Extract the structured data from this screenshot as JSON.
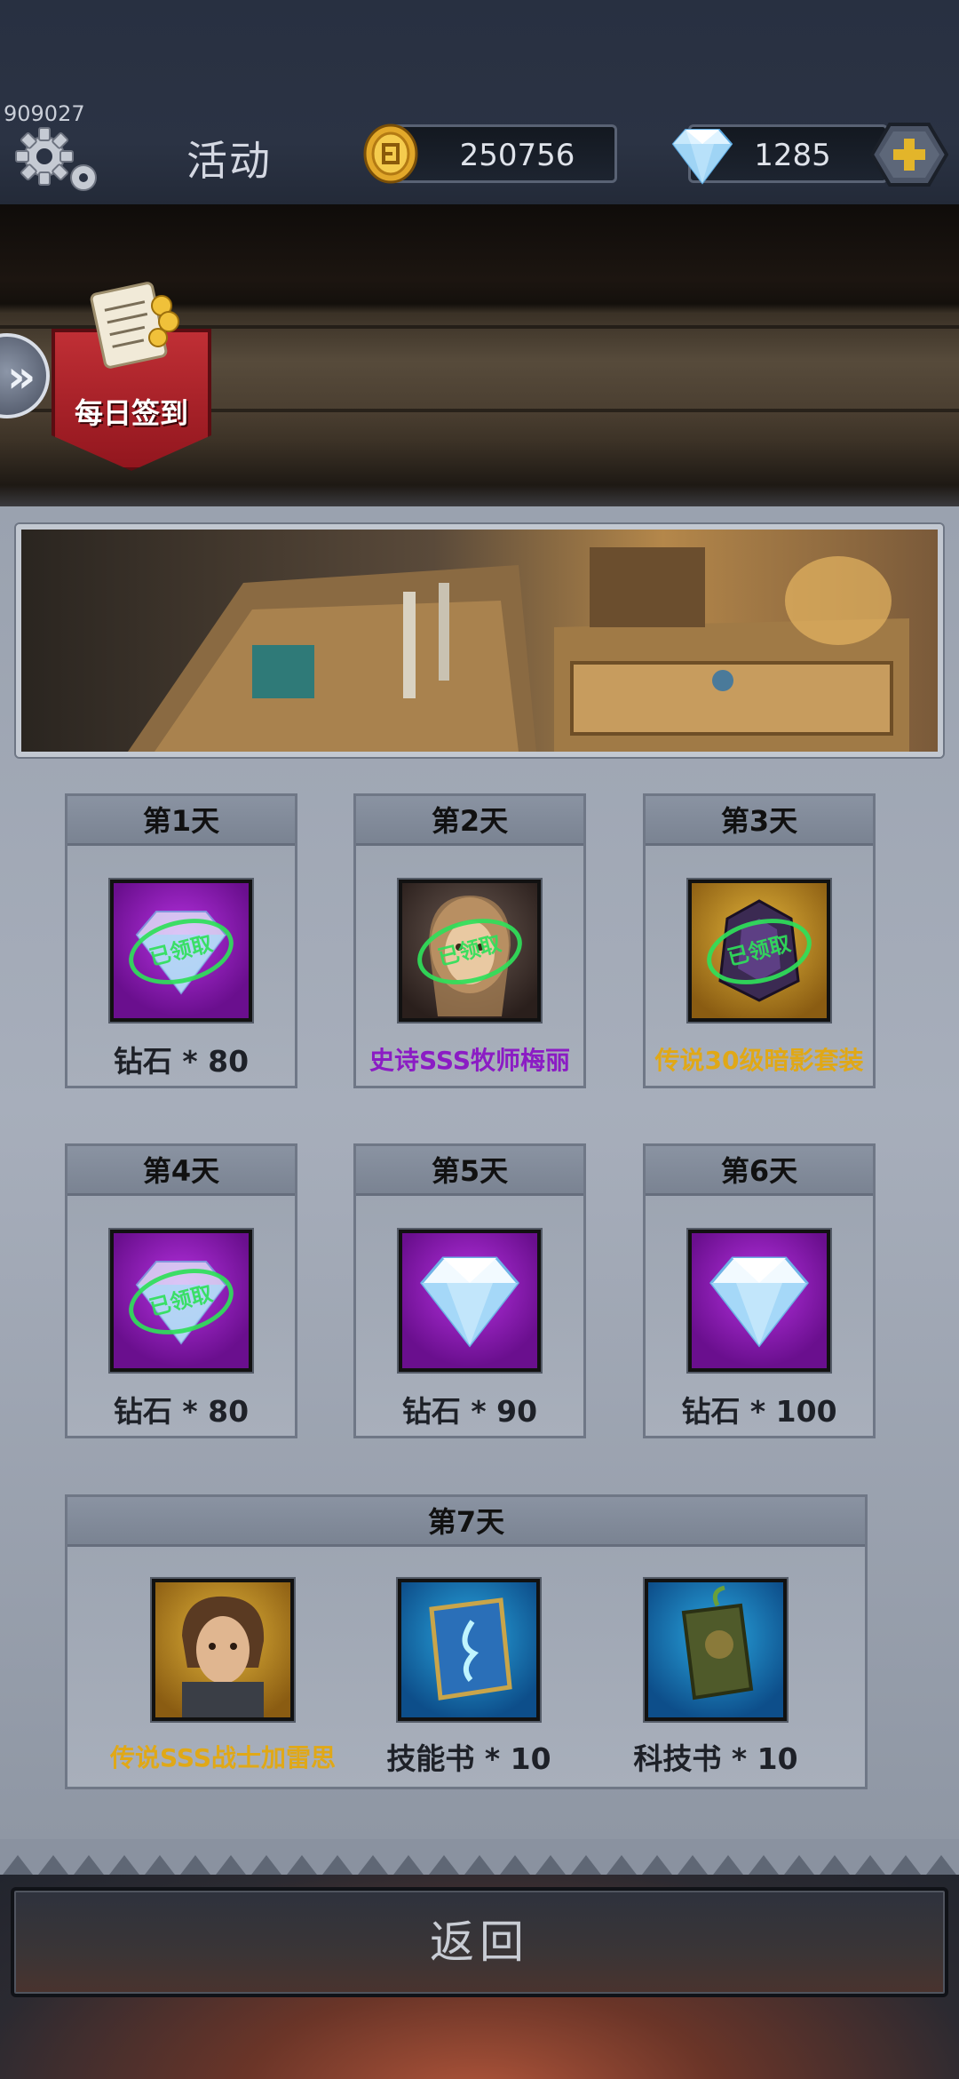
{
  "header": {
    "user_id": "909027",
    "title": "活动",
    "gold": "250756",
    "diamonds": "1285"
  },
  "tabs": {
    "daily_checkin": "每日签到"
  },
  "stamp_text": "已领取",
  "days": [
    {
      "label": "第1天",
      "reward": "钻石 * 80",
      "claimed": true,
      "icon": "diamond-icon"
    },
    {
      "label": "第2天",
      "reward": "史诗SSS牧师梅丽",
      "claimed": true,
      "icon": "priest-portrait-icon"
    },
    {
      "label": "第3天",
      "reward": "传说30级暗影套装",
      "claimed": true,
      "icon": "shadow-armor-icon"
    },
    {
      "label": "第4天",
      "reward": "钻石 * 80",
      "claimed": true,
      "icon": "diamond-icon"
    },
    {
      "label": "第5天",
      "reward": "钻石 * 90",
      "claimed": false,
      "icon": "diamond-icon"
    },
    {
      "label": "第6天",
      "reward": "钻石 * 100",
      "claimed": false,
      "icon": "diamond-icon"
    }
  ],
  "day7": {
    "label": "第7天",
    "items": [
      {
        "reward": "传说SSS战士加雷思",
        "icon": "warrior-portrait-icon"
      },
      {
        "reward": "技能书 * 10",
        "icon": "skill-book-icon"
      },
      {
        "reward": "科技书 * 10",
        "icon": "tech-book-icon"
      }
    ]
  },
  "footer": {
    "back_label": "返回"
  },
  "colors": {
    "epic": "#8b1cc4",
    "legendary": "#e0a817",
    "claimed_stamp": "#2fe05a"
  }
}
